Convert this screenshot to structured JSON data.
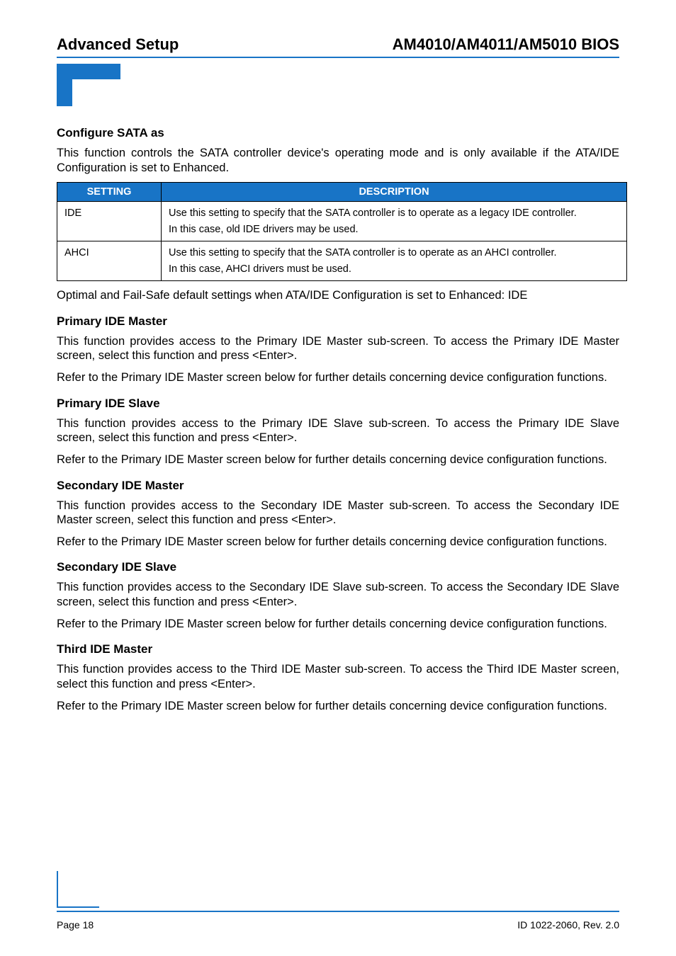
{
  "header": {
    "left": "Advanced Setup",
    "right": "AM4010/AM4011/AM5010 BIOS"
  },
  "sections": [
    {
      "heading": "Configure SATA as",
      "paragraphs": [
        "This function controls the SATA controller device's operating mode and is only available if the ATA/IDE Configuration is set to Enhanced."
      ],
      "table": {
        "headers": [
          "SETTING",
          "DESCRIPTION"
        ],
        "rows": [
          {
            "setting": "IDE",
            "desc_lines": [
              "Use this setting to specify that the SATA controller is to operate as a legacy IDE controller.",
              "In this case, old IDE drivers may be used."
            ]
          },
          {
            "setting": "AHCI",
            "desc_lines": [
              "Use this setting to specify that the SATA controller is to operate as an AHCI controller.",
              "In this case, AHCI drivers must be used."
            ]
          }
        ]
      },
      "post_table": "Optimal and Fail-Safe default settings when ATA/IDE Configuration is set to Enhanced: IDE"
    },
    {
      "heading": "Primary IDE Master",
      "paragraphs": [
        "This function provides access to the Primary IDE Master sub-screen. To access the Primary IDE Master screen, select this function and press <Enter>.",
        "Refer to the Primary IDE Master screen below for further details concerning device configuration functions."
      ]
    },
    {
      "heading": "Primary IDE Slave",
      "paragraphs": [
        "This function provides access to the Primary IDE Slave sub-screen. To access the Primary IDE Slave screen, select this function and press <Enter>.",
        "Refer to the Primary IDE Master screen below for further details concerning device configuration functions."
      ]
    },
    {
      "heading": "Secondary IDE Master",
      "paragraphs": [
        "This function provides access to the Secondary IDE Master sub-screen. To access the Secondary IDE Master screen, select this function and press <Enter>.",
        "Refer to the Primary IDE Master screen below for further details concerning device configuration functions."
      ]
    },
    {
      "heading": "Secondary IDE Slave",
      "paragraphs": [
        "This function provides access to the Secondary IDE Slave sub-screen. To access the Secondary IDE Slave screen, select this function and press <Enter>.",
        "Refer to the Primary IDE Master screen below for further details concerning device configuration functions."
      ]
    },
    {
      "heading": "Third IDE Master",
      "paragraphs": [
        "This function provides access to the Third IDE Master sub-screen. To access the Third IDE Master screen, select this function and press <Enter>.",
        "Refer to the Primary IDE Master screen below for further details concerning device configuration functions."
      ]
    }
  ],
  "footer": {
    "left": "Page 18",
    "right": "ID 1022-2060, Rev. 2.0"
  }
}
